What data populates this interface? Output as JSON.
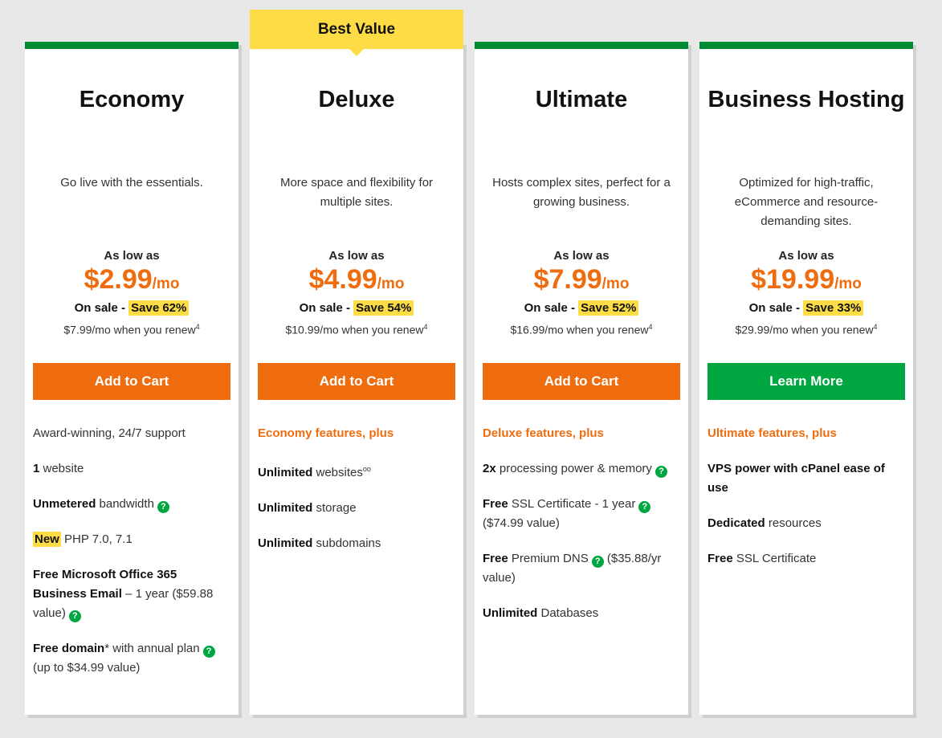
{
  "colors": {
    "orange": "#ef6c0f",
    "green": "#00a63f",
    "stripe": "#008a32",
    "yellow": "#fedc45"
  },
  "plans": [
    {
      "name": "Economy",
      "description": "Go live with the essentials.",
      "as_low_as": "As low as",
      "price": "$2.99",
      "per": "/mo",
      "on_sale": "On sale - ",
      "save": "Save 62%",
      "renew": "$7.99/mo when you renew",
      "renew_sup": "4",
      "button": "Add to Cart",
      "button_color": "#ef6c0f",
      "features": [
        [
          {
            "t": "Award-winning, 24/7 support"
          }
        ],
        [
          {
            "t": "1",
            "b": true
          },
          {
            "t": " website"
          }
        ],
        [
          {
            "t": "Unmetered",
            "b": true
          },
          {
            "t": " bandwidth"
          },
          {
            "q": "?"
          }
        ],
        [
          {
            "t": "New",
            "b": true,
            "hl": true
          },
          {
            "t": " PHP 7.0, 7.1"
          }
        ],
        [
          {
            "t": "Free Microsoft Office 365 Business Email",
            "b": true
          },
          {
            "t": " – 1 year ($59.88 value)"
          },
          {
            "q": "?"
          }
        ],
        [
          {
            "t": "Free domain",
            "b": true
          },
          {
            "t": "* with annual plan"
          },
          {
            "q": "?"
          },
          {
            "t": " (up to $34.99 value)"
          }
        ]
      ]
    },
    {
      "badge": "Best Value",
      "name": "Deluxe",
      "description": "More space and flexibility for multiple sites.",
      "as_low_as": "As low as",
      "price": "$4.99",
      "per": "/mo",
      "on_sale": "On sale - ",
      "save": "Save 54%",
      "renew": "$10.99/mo when you renew",
      "renew_sup": "4",
      "button": "Add to Cart",
      "button_color": "#ef6c0f",
      "plus": "Economy features, plus",
      "features": [
        [
          {
            "t": "Unlimited",
            "b": true
          },
          {
            "t": " websites"
          },
          {
            "sup": "oo"
          }
        ],
        [
          {
            "t": "Unlimited",
            "b": true
          },
          {
            "t": " storage"
          }
        ],
        [
          {
            "t": "Unlimited",
            "b": true
          },
          {
            "t": " subdomains"
          }
        ]
      ]
    },
    {
      "name": "Ultimate",
      "description": "Hosts complex sites, perfect for a growing business.",
      "as_low_as": "As low as",
      "price": "$7.99",
      "per": "/mo",
      "on_sale": "On sale - ",
      "save": "Save 52%",
      "renew": "$16.99/mo when you renew",
      "renew_sup": "4",
      "button": "Add to Cart",
      "button_color": "#ef6c0f",
      "plus": "Deluxe features, plus",
      "features": [
        [
          {
            "t": "2x",
            "b": true
          },
          {
            "t": " processing power & memory"
          },
          {
            "q": "?"
          }
        ],
        [
          {
            "t": "Free",
            "b": true
          },
          {
            "t": " SSL Certificate - 1 year"
          },
          {
            "q": "?"
          },
          {
            "t": " ($74.99 value)"
          }
        ],
        [
          {
            "t": "Free",
            "b": true
          },
          {
            "t": " Premium DNS"
          },
          {
            "q": "?"
          },
          {
            "t": " ($35.88/yr value)"
          }
        ],
        [
          {
            "t": "Unlimited",
            "b": true
          },
          {
            "t": " Databases"
          }
        ]
      ]
    },
    {
      "name": "Business Hosting",
      "description": "Optimized for high-traffic, eCommerce and resource-demanding sites.",
      "as_low_as": "As low as",
      "price": "$19.99",
      "per": "/mo",
      "on_sale": "On sale - ",
      "save": "Save 33%",
      "renew": "$29.99/mo when you renew",
      "renew_sup": "4",
      "button": "Learn More",
      "button_color": "#00a63f",
      "plus": "Ultimate features, plus",
      "features": [
        [
          {
            "t": "VPS power with cPanel ease of use",
            "b": true
          }
        ],
        [
          {
            "t": "Dedicated",
            "b": true
          },
          {
            "t": " resources"
          }
        ],
        [
          {
            "t": "Free",
            "b": true
          },
          {
            "t": " SSL Certificate"
          }
        ]
      ]
    }
  ]
}
